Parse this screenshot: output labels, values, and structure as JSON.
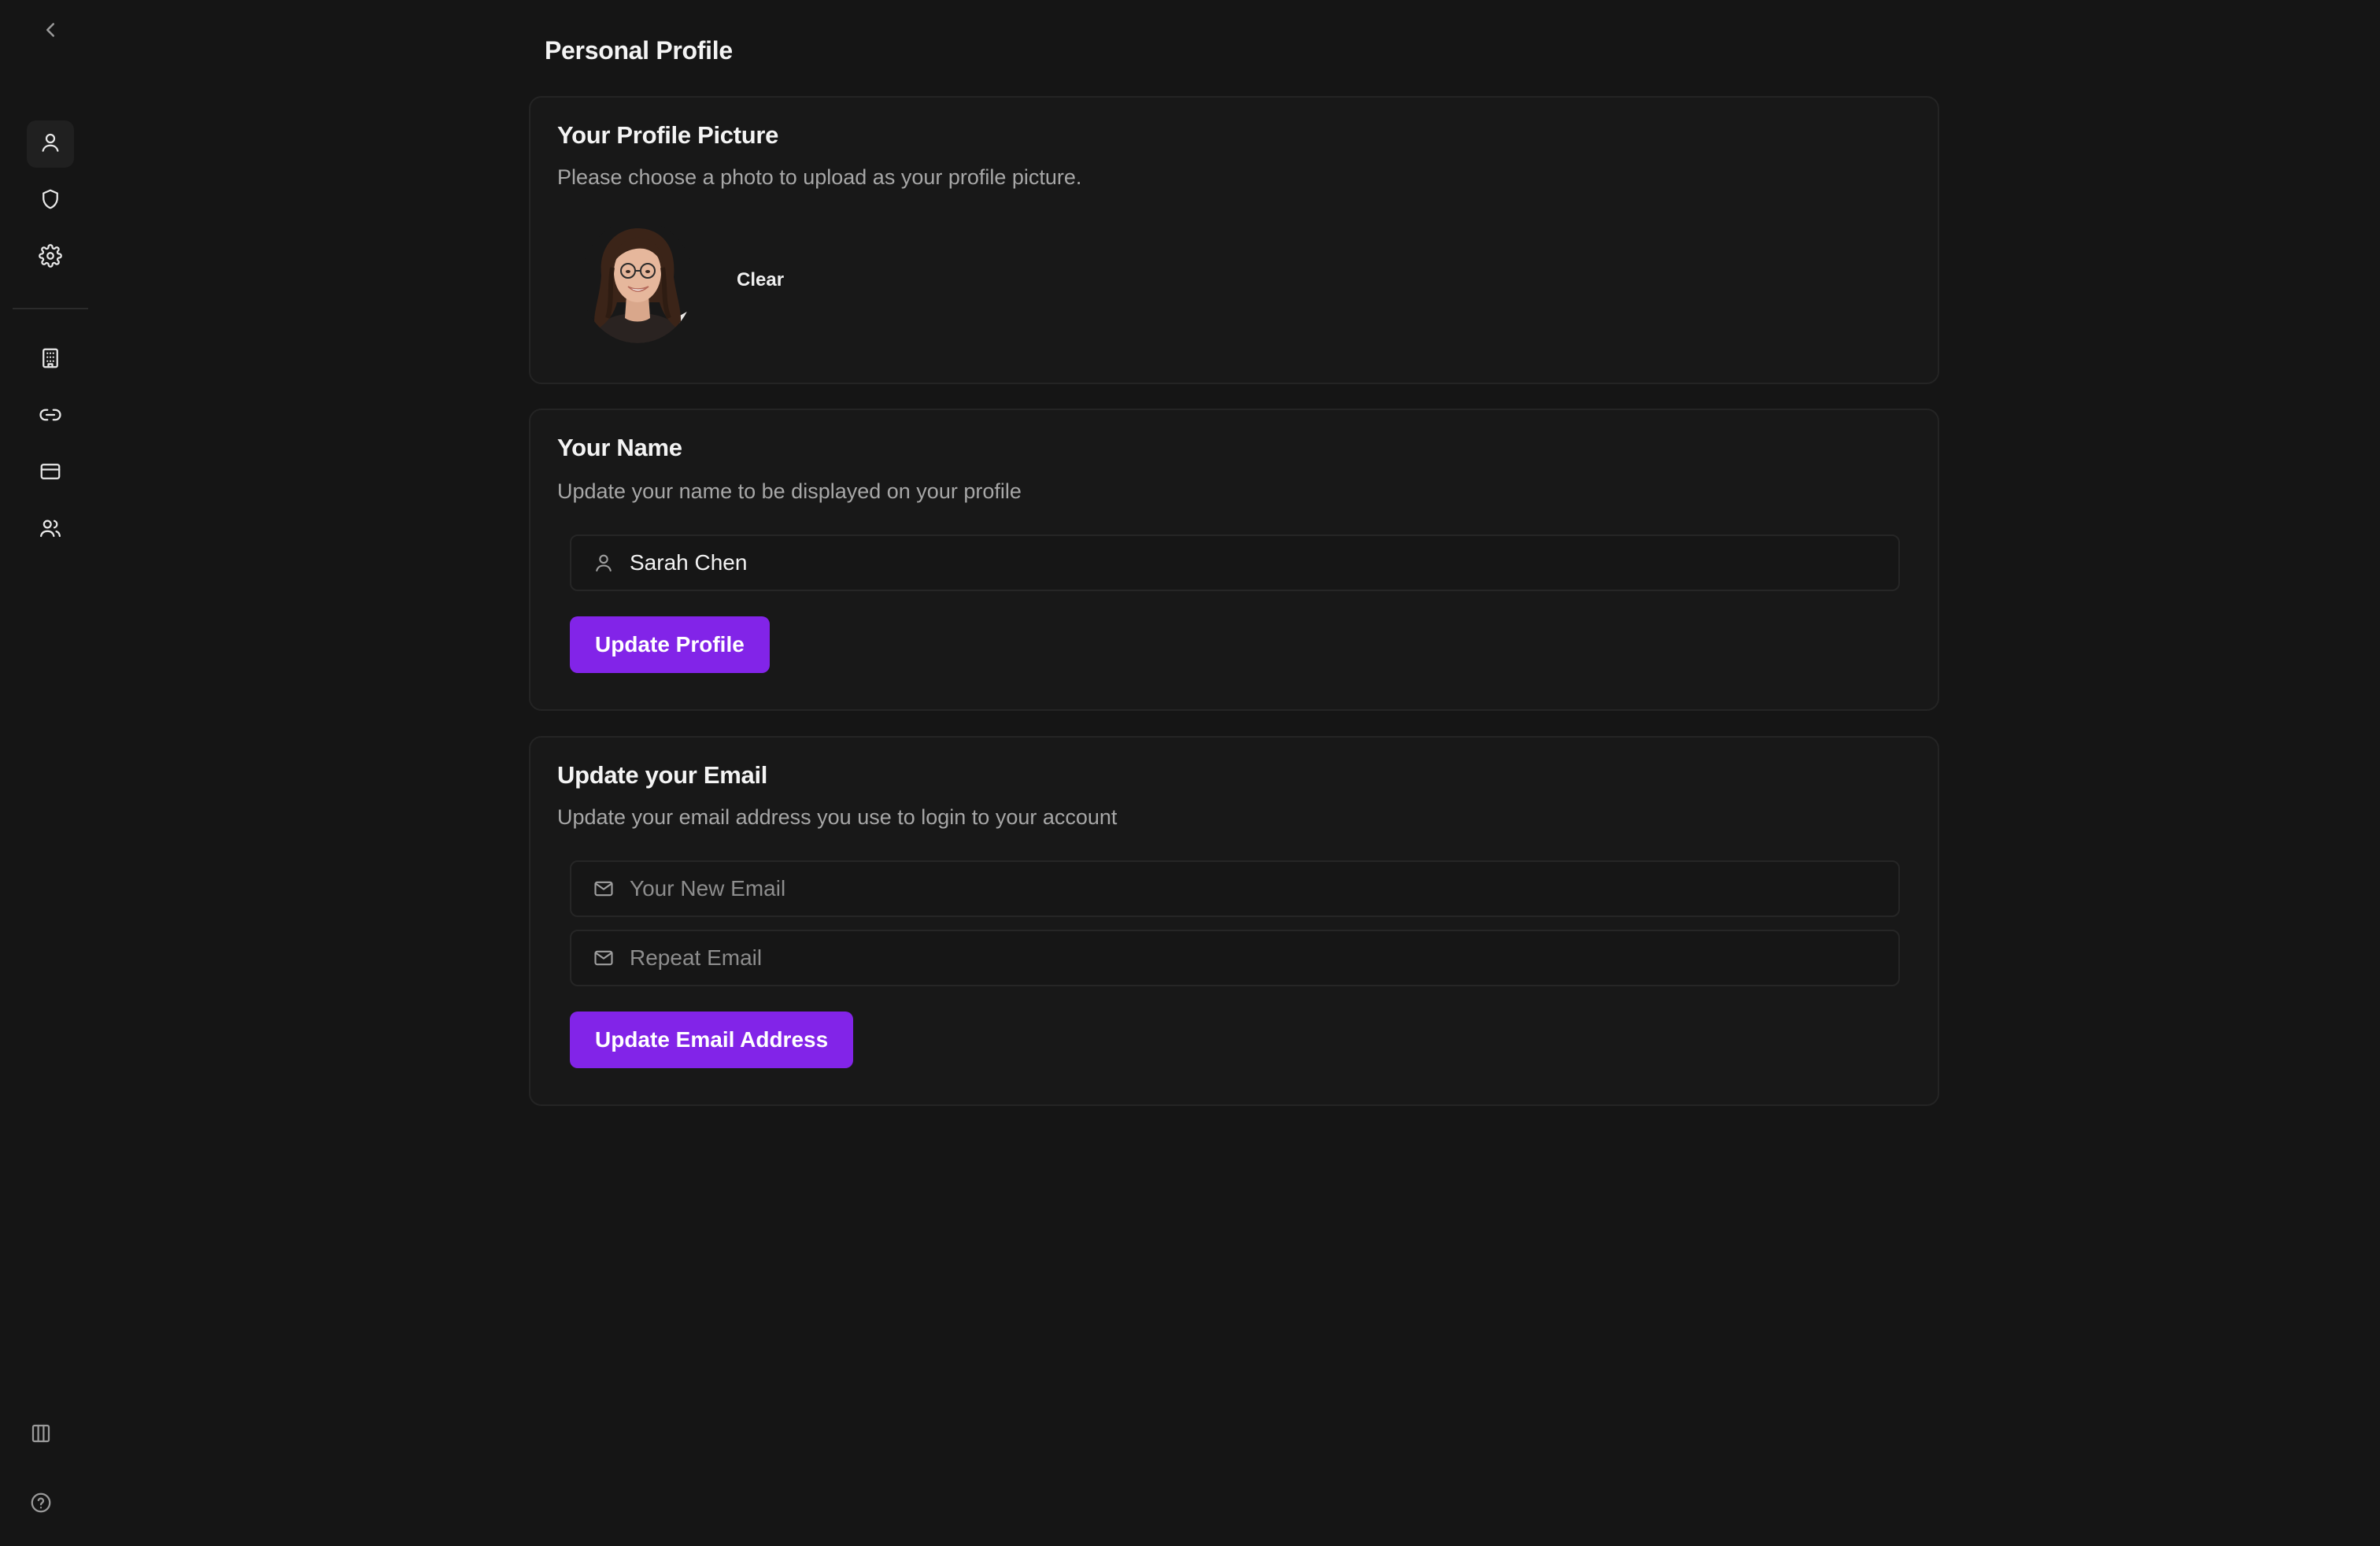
{
  "page": {
    "title": "Personal Profile"
  },
  "sidebar": {
    "collapse_icon": "chevron-left-icon",
    "items": [
      {
        "icon": "user-icon",
        "active": true
      },
      {
        "icon": "shield-icon",
        "active": false
      },
      {
        "icon": "gear-icon",
        "active": false
      },
      {
        "icon": "building-icon",
        "active": false
      },
      {
        "icon": "link-icon",
        "active": false
      },
      {
        "icon": "credit-card-icon",
        "active": false
      },
      {
        "icon": "users-icon",
        "active": false
      }
    ],
    "bottom_items": [
      {
        "icon": "columns-icon"
      },
      {
        "icon": "help-circle-icon"
      }
    ]
  },
  "profile_picture": {
    "title": "Your Profile Picture",
    "description": "Please choose a photo to upload as your profile picture.",
    "clear_label": "Clear"
  },
  "name_section": {
    "title": "Your Name",
    "description": "Update your name to be displayed on your profile",
    "name_value": "Sarah Chen",
    "button_label": "Update Profile"
  },
  "email_section": {
    "title": "Update your Email",
    "description": "Update your email address you use to login to your account",
    "new_email_placeholder": "Your New Email",
    "repeat_email_placeholder": "Repeat Email",
    "button_label": "Update Email Address"
  },
  "colors": {
    "background": "#151515",
    "card": "#181818",
    "accent": "#8224e8"
  }
}
